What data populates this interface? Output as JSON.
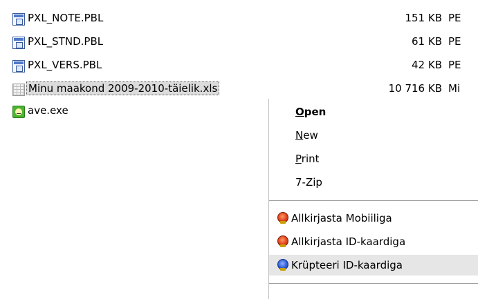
{
  "files": [
    {
      "name": "PXL_NOTE.PBL",
      "size": "151 KB",
      "type": "PE",
      "icon": "pbl-file-icon"
    },
    {
      "name": "PXL_STND.PBL",
      "size": "61 KB",
      "type": "PE",
      "icon": "pbl-file-icon"
    },
    {
      "name": "PXL_VERS.PBL",
      "size": "42 KB",
      "type": "PE",
      "icon": "pbl-file-icon"
    },
    {
      "name": "Minu maakond 2009-2010-täielik.xls",
      "size": "10 716 KB",
      "type": "Mi",
      "icon": "excel-file-icon",
      "selected": true
    },
    {
      "name": "ave.exe",
      "size": "",
      "type": "",
      "icon": "exe-file-icon"
    }
  ],
  "context_menu": {
    "items": [
      {
        "accel": "O",
        "rest": "pen",
        "default": true
      },
      {
        "accel": "N",
        "rest": "ew"
      },
      {
        "accel": "P",
        "rest": "rint"
      },
      {
        "accel": "",
        "rest": "7-Zip"
      }
    ],
    "signing_items": [
      {
        "label": "Allkirjasta Mobiiliga",
        "icon": "id-card-sign-icon",
        "color": "#e0401a"
      },
      {
        "label": "Allkirjasta ID-kaardiga",
        "icon": "id-card-sign-icon",
        "color": "#e0401a"
      },
      {
        "label": "Krüpteeri ID-kaardiga",
        "icon": "encrypt-icon",
        "color": "#2f5fd6",
        "hover": true
      }
    ]
  }
}
